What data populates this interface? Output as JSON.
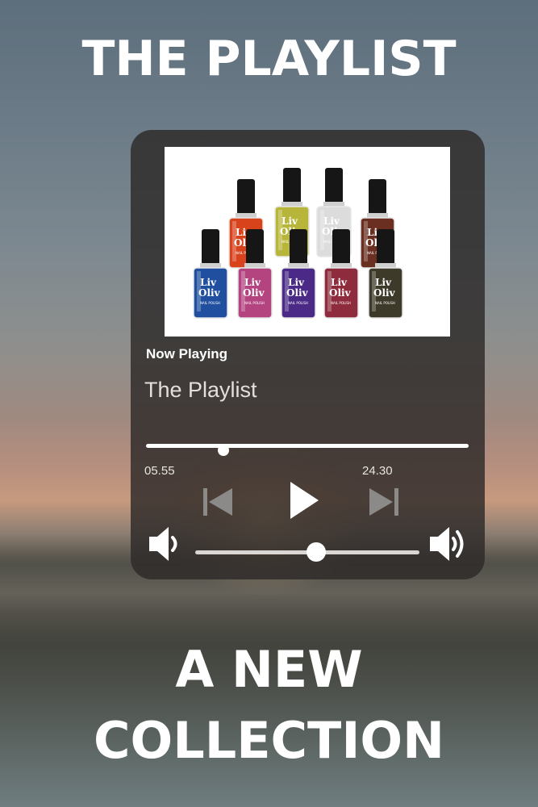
{
  "poster": {
    "top_title": "THE PLAYLIST",
    "bottom_title_line1": "A NEW",
    "bottom_title_line2": "COLLECTION"
  },
  "player": {
    "now_playing_label": "Now Playing",
    "track_title": "The Playlist",
    "time_elapsed": "05.55",
    "time_total": "24.30",
    "progress_fraction": 0.24,
    "volume_fraction": 0.54,
    "album_art": {
      "brand_line1": "Liv",
      "brand_line2": "Oliv",
      "product_caption": "NAIL POLISH",
      "bottle_colors": [
        "#d8431c",
        "#b7b63a",
        "#dcdcdc",
        "#6b2f22",
        "#1f4f9e",
        "#b3447f",
        "#4a2a86",
        "#8e2b3c",
        "#3e3a2a"
      ]
    },
    "icons": {
      "previous": "skip-previous-icon",
      "play": "play-icon",
      "next": "skip-next-icon",
      "volume_low": "volume-low-icon",
      "volume_high": "volume-high-icon"
    }
  }
}
